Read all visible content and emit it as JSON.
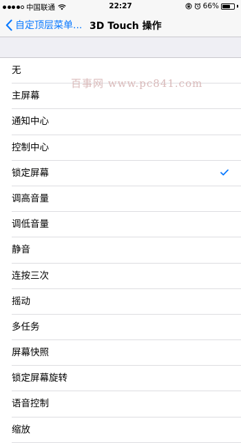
{
  "status": {
    "carrier": "中国联通",
    "time": "22:27",
    "battery": "66%",
    "battery_level": 0.66,
    "signal_bars": 4
  },
  "nav": {
    "back_label": "自定顶层菜单...",
    "title": "3D Touch 操作"
  },
  "options": [
    {
      "label": "无",
      "selected": false
    },
    {
      "label": "主屏幕",
      "selected": false
    },
    {
      "label": "通知中心",
      "selected": false
    },
    {
      "label": "控制中心",
      "selected": false
    },
    {
      "label": "锁定屏幕",
      "selected": true
    },
    {
      "label": "调高音量",
      "selected": false
    },
    {
      "label": "调低音量",
      "selected": false
    },
    {
      "label": "静音",
      "selected": false
    },
    {
      "label": "连按三次",
      "selected": false
    },
    {
      "label": "摇动",
      "selected": false
    },
    {
      "label": "多任务",
      "selected": false
    },
    {
      "label": "屏幕快照",
      "selected": false
    },
    {
      "label": "锁定屏幕旋转",
      "selected": false
    },
    {
      "label": "语音控制",
      "selected": false
    },
    {
      "label": "缩放",
      "selected": false
    }
  ],
  "watermark": "百事网 www.pc841.com",
  "colors": {
    "accent": "#0a7aff",
    "background": "#efeff4"
  }
}
